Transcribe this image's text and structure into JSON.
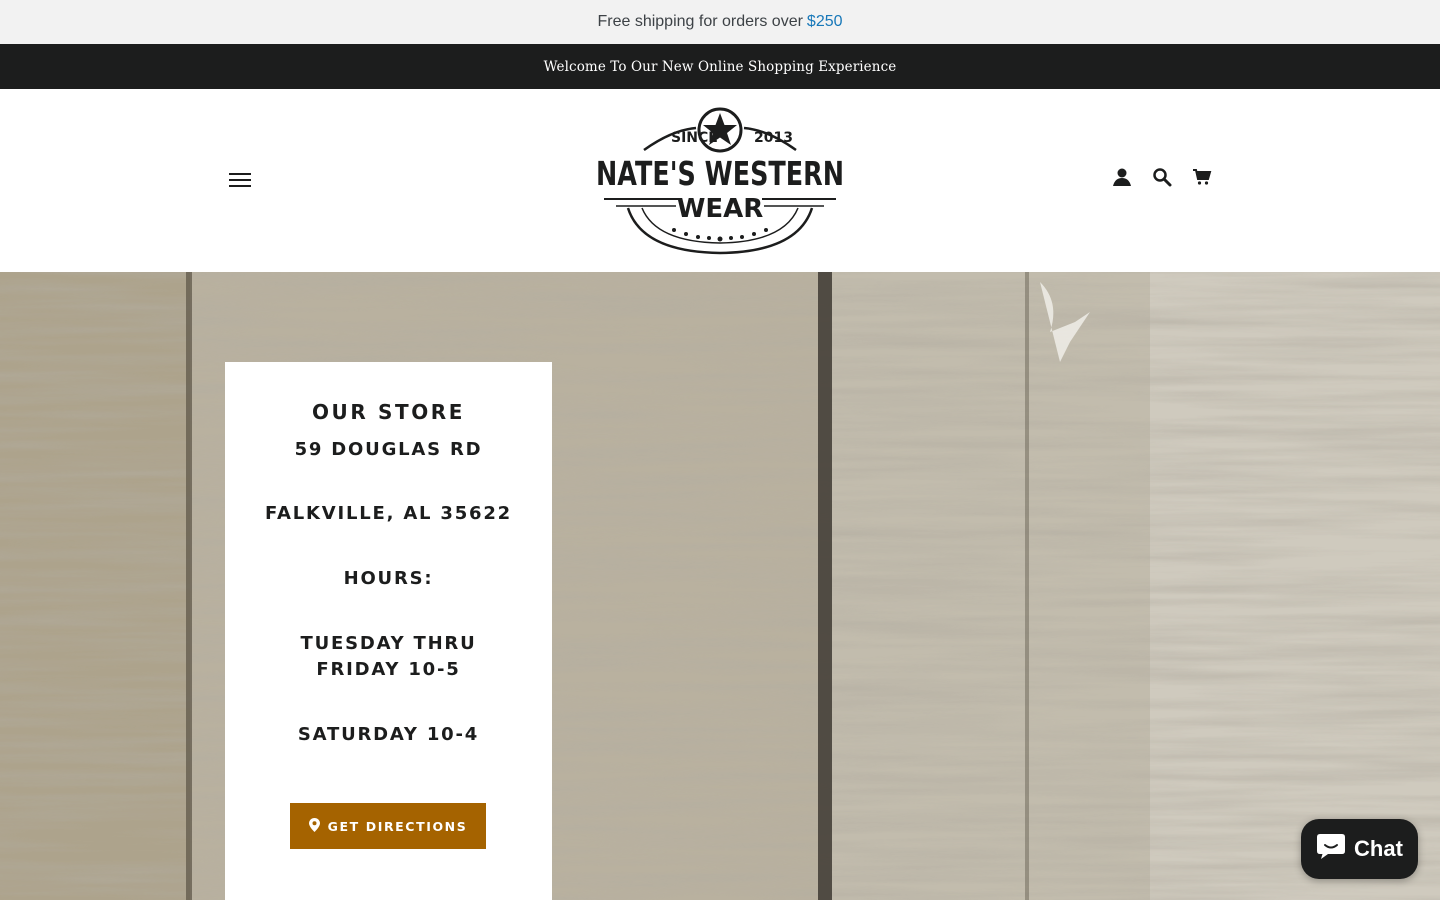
{
  "shipping_bar": {
    "text": "Free shipping for orders over",
    "amount": "$250"
  },
  "announcement": {
    "text": "Welcome To Our New Online Shopping Experience"
  },
  "header": {
    "menu_icon": "hamburger-menu-icon",
    "logo": {
      "since": "SINCE",
      "year": "2013",
      "line1": "NATE'S WESTERN",
      "line2": "WEAR"
    },
    "icons": [
      "account-icon",
      "search-icon",
      "cart-icon"
    ]
  },
  "store": {
    "title": "OUR STORE",
    "address_line1": "59 DOUGLAS RD",
    "address_line2": "FALKVILLE, AL 35622",
    "hours_label": "HOURS:",
    "hours_weekday": "TUESDAY THRU FRIDAY 10-5",
    "hours_saturday": "SATURDAY 10-4",
    "directions_label": "GET DIRECTIONS"
  },
  "chat": {
    "label": "Chat"
  },
  "colors": {
    "accent": "#a56300",
    "dark": "#1c1d1d",
    "link": "#1878b9",
    "topbar": "#f2f2f2"
  }
}
